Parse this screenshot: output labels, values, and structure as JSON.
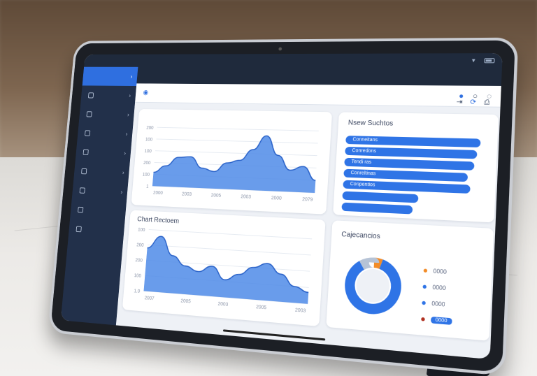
{
  "status_bar": {
    "left_items": [
      "",
      "",
      ""
    ],
    "time": ""
  },
  "sidebar": {
    "items": [
      {
        "label": "",
        "active": true
      },
      {
        "label": "",
        "active": false
      },
      {
        "label": "",
        "active": false
      },
      {
        "label": "",
        "active": false
      },
      {
        "label": "",
        "active": false
      },
      {
        "label": "",
        "active": false
      },
      {
        "label": "",
        "active": false
      },
      {
        "label": "",
        "active": false
      },
      {
        "label": "",
        "active": false
      }
    ]
  },
  "topbar": {
    "items": [
      "",
      "",
      ""
    ]
  },
  "subheader": {
    "title": ""
  },
  "top_chart": {
    "title": "",
    "subtitle": "",
    "x_ticks": [
      "2000",
      "2003",
      "2005",
      "2003",
      "2000",
      "2079"
    ],
    "y_ticks": [
      "200",
      "100",
      "100",
      "200",
      "100",
      "1"
    ],
    "values": [
      28,
      42,
      60,
      62,
      40,
      34,
      52,
      58,
      80,
      108,
      70,
      42,
      50,
      24
    ]
  },
  "status_panel": {
    "title": "Nsew Suchtos",
    "bars": [
      "Conneitans",
      "Conredons",
      "Tendi ras",
      "Conreltinas",
      "Conpentios",
      "",
      ""
    ],
    "bar_fractions": [
      0.98,
      0.96,
      0.94,
      0.9,
      0.92,
      0.56,
      0.52
    ]
  },
  "bottom_chart": {
    "title": "Chart Rectoem",
    "x_ticks": [
      "2007",
      "2005",
      "2003",
      "2005",
      "2003"
    ],
    "y_ticks": [
      "100",
      "200",
      "200",
      "100",
      "1.0"
    ],
    "values": [
      56,
      72,
      48,
      36,
      30,
      38,
      22,
      30,
      40,
      46,
      34,
      20,
      14
    ]
  },
  "donut": {
    "title": "Cajecancios",
    "segments": [
      {
        "value": 0.05,
        "color": "#f28c28"
      },
      {
        "value": 0.86,
        "color": "#2f74e6"
      },
      {
        "value": 0.09,
        "color": "#b6c3d6"
      }
    ],
    "legend": [
      {
        "label": "0000",
        "color": "#f28c28"
      },
      {
        "label": "0000",
        "color": "#2f74e6"
      },
      {
        "label": "0000",
        "color": "#2f74e6"
      },
      {
        "label": "0000",
        "color": "#b03020",
        "pill": true
      }
    ]
  },
  "colors": {
    "accent": "#2f74e6",
    "sidebar_bg": "#22304a",
    "screen_bg": "#eef1f6"
  }
}
